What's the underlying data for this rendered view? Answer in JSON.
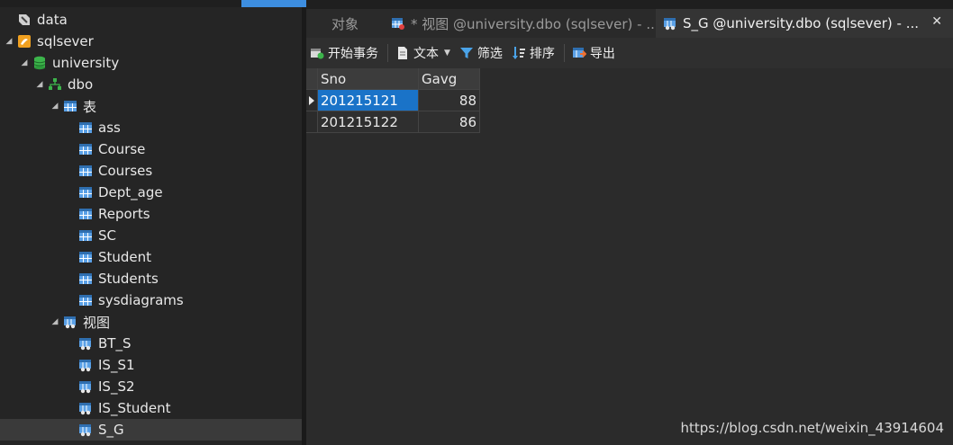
{
  "tree": {
    "items": [
      {
        "label": "data",
        "icon": "connection-icon",
        "level": 0,
        "twisty": ""
      },
      {
        "label": "sqlsever",
        "icon": "server-icon",
        "level": 0,
        "twisty": "◢"
      },
      {
        "label": "university",
        "icon": "database-icon",
        "level": 1,
        "twisty": "◢"
      },
      {
        "label": "dbo",
        "icon": "schema-icon",
        "level": 2,
        "twisty": "◢"
      },
      {
        "label": "表",
        "icon": "table-icon",
        "level": 3,
        "twisty": "◢"
      },
      {
        "label": "ass",
        "icon": "table-icon",
        "level": 4,
        "twisty": ""
      },
      {
        "label": "Course",
        "icon": "table-icon",
        "level": 4,
        "twisty": ""
      },
      {
        "label": "Courses",
        "icon": "table-icon",
        "level": 4,
        "twisty": ""
      },
      {
        "label": "Dept_age",
        "icon": "table-icon",
        "level": 4,
        "twisty": ""
      },
      {
        "label": "Reports",
        "icon": "table-icon",
        "level": 4,
        "twisty": ""
      },
      {
        "label": "SC",
        "icon": "table-icon",
        "level": 4,
        "twisty": ""
      },
      {
        "label": "Student",
        "icon": "table-icon",
        "level": 4,
        "twisty": ""
      },
      {
        "label": "Students",
        "icon": "table-icon",
        "level": 4,
        "twisty": ""
      },
      {
        "label": "sysdiagrams",
        "icon": "table-icon",
        "level": 4,
        "twisty": ""
      },
      {
        "label": "视图",
        "icon": "view-icon",
        "level": 3,
        "twisty": "◢"
      },
      {
        "label": "BT_S",
        "icon": "view-icon",
        "level": 4,
        "twisty": ""
      },
      {
        "label": "IS_S1",
        "icon": "view-icon",
        "level": 4,
        "twisty": ""
      },
      {
        "label": "IS_S2",
        "icon": "view-icon",
        "level": 4,
        "twisty": ""
      },
      {
        "label": "IS_Student",
        "icon": "view-icon",
        "level": 4,
        "twisty": ""
      },
      {
        "label": "S_G",
        "icon": "view-icon",
        "level": 4,
        "twisty": "",
        "selected": true
      }
    ]
  },
  "tabs": {
    "items": [
      {
        "label": "对象",
        "icon": "",
        "active": false
      },
      {
        "label": "* 视图 @university.dbo (sqlsever) - ...",
        "icon": "view-design-icon",
        "active": false
      },
      {
        "label": "S_G @university.dbo (sqlsever) - ...",
        "icon": "view-icon",
        "active": true
      }
    ],
    "close_glyph": "✕"
  },
  "toolbar": {
    "begin_transaction": "开始事务",
    "text": "文本",
    "filter": "筛选",
    "sort": "排序",
    "export": "导出"
  },
  "grid": {
    "columns": [
      "Sno",
      "Gavg"
    ],
    "rows": [
      [
        "201215121",
        "88"
      ],
      [
        "201215122",
        "86"
      ]
    ]
  },
  "watermark": "https://blog.csdn.net/weixin_43914604",
  "colors": {
    "accent": "#1a73c8",
    "tree_bg": "#252525",
    "table_icon": "#5aa0e6",
    "db_icon": "#3cb44b",
    "server_icon": "#f0a020"
  }
}
